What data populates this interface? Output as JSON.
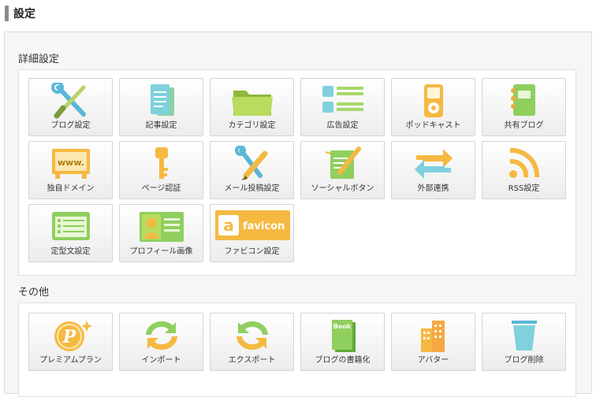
{
  "page": {
    "title": "設定"
  },
  "sections": {
    "advanced": {
      "heading": "詳細設定",
      "items": [
        {
          "label": "ブログ設定"
        },
        {
          "label": "記事設定"
        },
        {
          "label": "カテゴリ設定"
        },
        {
          "label": "広告設定"
        },
        {
          "label": "ポッドキャスト"
        },
        {
          "label": "共有ブログ"
        },
        {
          "label": "独自ドメイン",
          "icon_text": "www."
        },
        {
          "label": "ページ認証"
        },
        {
          "label": "メール投稿設定"
        },
        {
          "label": "ソーシャルボタン"
        },
        {
          "label": "外部連携"
        },
        {
          "label": "RSS設定"
        },
        {
          "label": "定型文設定"
        },
        {
          "label": "プロフィール画像"
        },
        {
          "label": "ファビコン設定",
          "icon_text": "favicon"
        }
      ]
    },
    "other": {
      "heading": "その他",
      "items": [
        {
          "label": "プレミアムプラン",
          "icon_text": "P"
        },
        {
          "label": "インポート"
        },
        {
          "label": "エクスポート"
        },
        {
          "label": "ブログの書籍化",
          "icon_text": "Book"
        },
        {
          "label": "アバター"
        },
        {
          "label": "ブログ削除"
        }
      ]
    }
  }
}
